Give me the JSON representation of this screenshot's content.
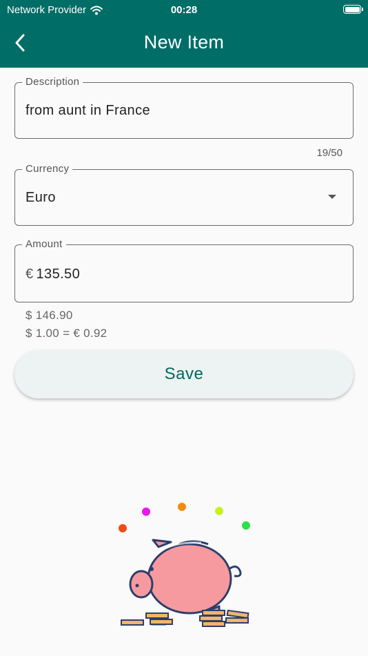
{
  "status_bar": {
    "carrier": "Network Provider",
    "time": "00:28"
  },
  "app_bar": {
    "title": "New Item",
    "back_icon": "chevron-left-icon"
  },
  "form": {
    "description": {
      "label": "Description",
      "value": "from aunt in France",
      "counter": "19/50"
    },
    "currency": {
      "label": "Currency",
      "value": "Euro",
      "icon": "dropdown-arrow-icon"
    },
    "amount": {
      "label": "Amount",
      "prefix": "€",
      "value": "135.50"
    },
    "conversion": {
      "converted": "$ 146.90",
      "rate": "$ 1.00 = € 0.92"
    }
  },
  "save_button": {
    "label": "Save"
  },
  "colors": {
    "primary": "#006d67",
    "save_text": "#00695f",
    "pig": "#f69a9f",
    "coin": "#f2b56b",
    "outline": "#2c3e6b"
  },
  "illustration": {
    "name": "piggy-bank-illustration",
    "confetti_colors": [
      "#f24a12",
      "#ea18ea",
      "#f28c12",
      "#c8f020",
      "#2ce04a"
    ]
  }
}
